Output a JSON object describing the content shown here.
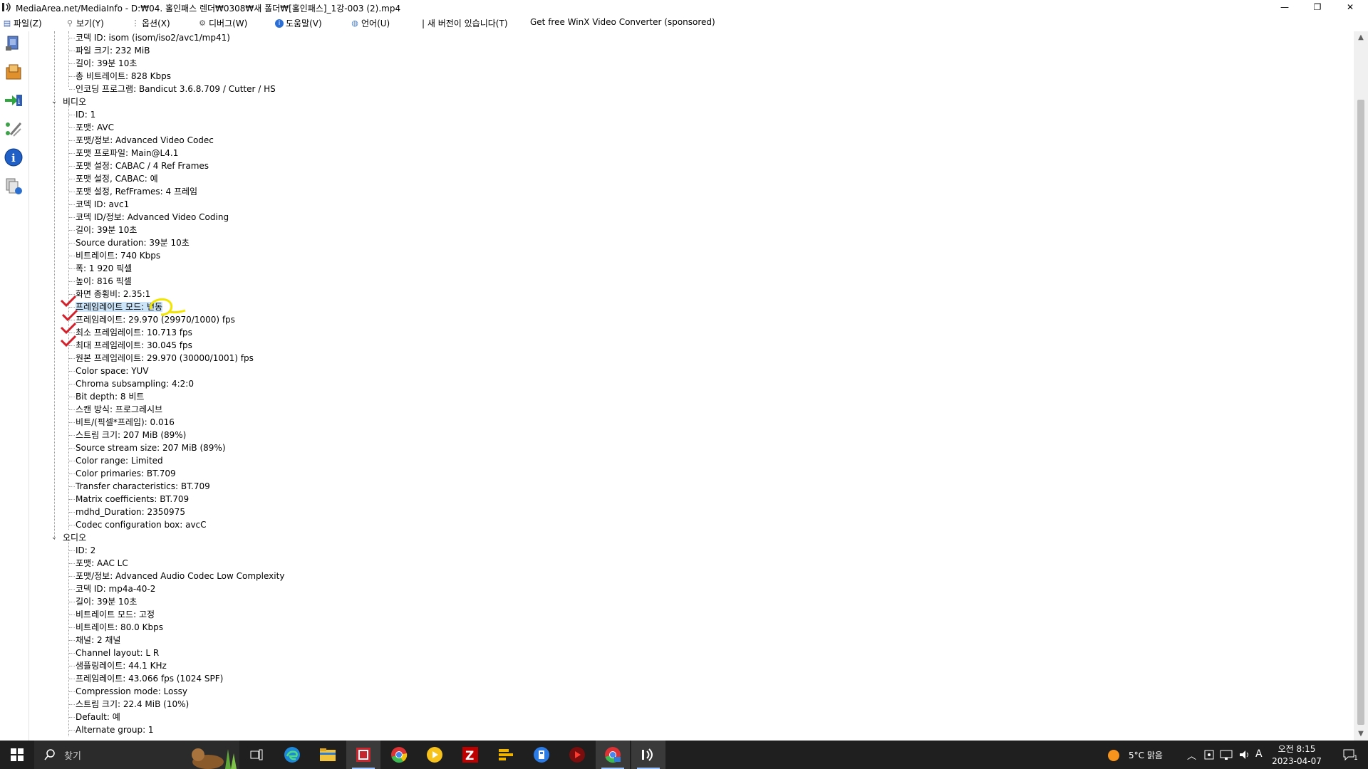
{
  "window": {
    "title": "MediaArea.net/MediaInfo - D:₩04. 홀인패스 렌더₩0308₩새 폴더₩[홀인패스]_1강-003 (2).mp4",
    "minimize": "—",
    "maximize": "❐",
    "close": "✕"
  },
  "menu": {
    "file": "파일(Z)",
    "view": "보기(Y)",
    "options": "옵션(X)",
    "debug": "디버그(W)",
    "help": "도움말(V)",
    "language": "언어(U)",
    "newversion": "| 새 버전이 있습니다(T)",
    "sponsored": "Get free WinX Video Converter (sponsored)"
  },
  "general_tail": [
    "코덱 ID: isom (isom/iso2/avc1/mp41)",
    "파일 크기: 232 MiB",
    "길이: 39분 10초",
    "총 비트레이트: 828 Kbps",
    "인코딩 프로그램: Bandicut 3.6.8.709 / Cutter / HS"
  ],
  "video": {
    "label": "비디오",
    "rows": [
      "ID: 1",
      "포맷: AVC",
      "포맷/정보: Advanced Video Codec",
      "포맷 프로파일: Main@L4.1",
      "포맷 설정: CABAC / 4 Ref Frames",
      "포맷 설정, CABAC: 예",
      "포맷 설정, RefFrames: 4 프레임",
      "코덱 ID: avc1",
      "코덱 ID/정보: Advanced Video Coding",
      "길이: 39분 10초",
      "Source duration: 39분 10초",
      "비트레이트: 740 Kbps",
      "폭: 1 920 픽셀",
      "높이: 816 픽셀",
      "화면 종횡비: 2.35:1",
      "프레임레이트 모드: 변동",
      "프레임레이트: 29.970 (29970/1000) fps",
      "최소 프레임레이트: 10.713 fps",
      "최대 프레임레이트: 30.045 fps",
      "원본 프레임레이트: 29.970 (30000/1001) fps",
      "Color space: YUV",
      "Chroma subsampling: 4:2:0",
      "Bit depth: 8 비트",
      "스캔 방식: 프로그레시브",
      "비트/(픽셀*프레임): 0.016",
      "스트림 크기: 207 MiB (89%)",
      "Source stream size: 207 MiB (89%)",
      "Color range: Limited",
      "Color primaries: BT.709",
      "Transfer characteristics: BT.709",
      "Matrix coefficients: BT.709",
      "mdhd_Duration: 2350975",
      "Codec configuration box: avcC"
    ]
  },
  "audio": {
    "label": "오디오",
    "rows": [
      "ID: 2",
      "포맷: AAC LC",
      "포맷/정보: Advanced Audio Codec Low Complexity",
      "코덱 ID: mp4a-40-2",
      "길이: 39분 10초",
      "비트레이트 모드: 고정",
      "비트레이트: 80.0 Kbps",
      "채널: 2 채널",
      "Channel layout: L R",
      "샘플링레이트: 44.1 KHz",
      "프레임레이트: 43.066 fps (1024 SPF)",
      "Compression mode: Lossy",
      "스트림 크기: 22.4 MiB (10%)",
      "Default: 예",
      "Alternate group: 1"
    ]
  },
  "taskbar": {
    "search_placeholder": "찾기",
    "weather": "5°C  맑음",
    "ime": "A",
    "time": "오전 8:15",
    "date": "2023-04-07",
    "notification_count": "1"
  },
  "colors": {
    "highlight": "#cce4f7",
    "check_mark": "#d4202a",
    "circle_mark": "#f2e600",
    "taskbar": "#1f1f1f"
  }
}
